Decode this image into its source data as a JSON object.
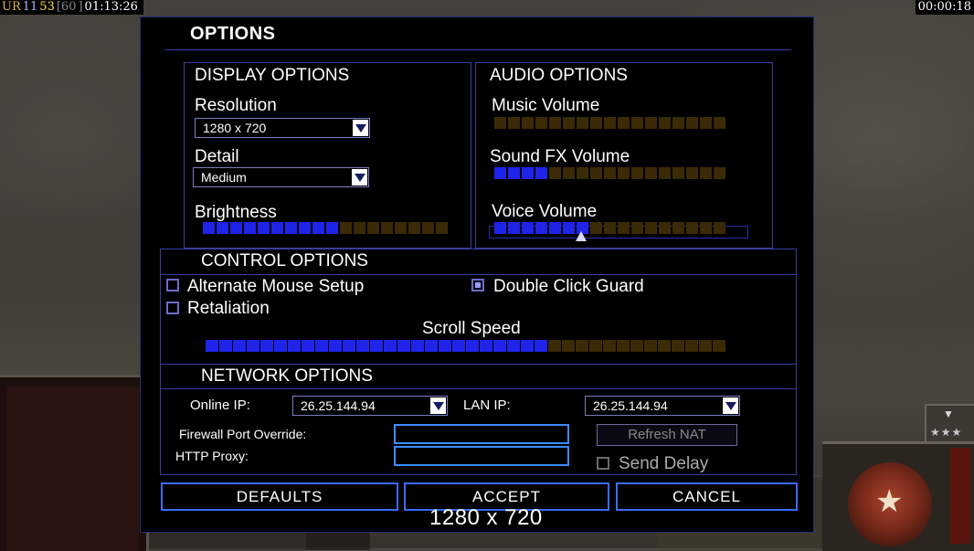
{
  "hud": {
    "left": [
      {
        "text": "UR",
        "color": "#e0b040"
      },
      {
        "text": "11",
        "color": "#b0b0ff"
      },
      {
        "text": "53",
        "color": "#ffe040"
      },
      {
        "text": "60",
        "color": "#888888"
      },
      {
        "text": "01:13:26",
        "color": "#ffffff"
      }
    ],
    "right": "00:00:18"
  },
  "dialog": {
    "title": "OPTIONS",
    "display": {
      "title": "DISPLAY OPTIONS",
      "resolution_label": "Resolution",
      "resolution_value": "1280 x 720",
      "detail_label": "Detail",
      "detail_value": "Medium",
      "brightness_label": "Brightness",
      "brightness_level": {
        "on": 10,
        "total": 18
      }
    },
    "audio": {
      "title": "AUDIO OPTIONS",
      "music_label": "Music Volume",
      "music_level": {
        "on": 0,
        "total": 17
      },
      "sfx_label": "Sound FX Volume",
      "sfx_level": {
        "on": 4,
        "total": 17
      },
      "voice_label": "Voice Volume",
      "voice_level": {
        "on": 7,
        "total": 17
      }
    },
    "control": {
      "title": "CONTROL OPTIONS",
      "alt_mouse_label": "Alternate Mouse Setup",
      "alt_mouse_checked": false,
      "double_click_label": "Double Click Guard",
      "double_click_checked": true,
      "retaliation_label": "Retaliation",
      "retaliation_checked": false,
      "scroll_label": "Scroll Speed",
      "scroll_level": {
        "on": 25,
        "total": 38
      }
    },
    "network": {
      "title": "NETWORK OPTIONS",
      "online_ip_label": "Online IP:",
      "online_ip_value": "26.25.144.94",
      "lan_ip_label": "LAN IP:",
      "lan_ip_value": "26.25.144.94",
      "firewall_label": "Firewall Port Override:",
      "firewall_value": "",
      "proxy_label": "HTTP Proxy:",
      "proxy_value": "",
      "refresh_nat_label": "Refresh NAT",
      "send_delay_label": "Send Delay",
      "send_delay_checked": false
    },
    "buttons": {
      "defaults": "DEFAULTS",
      "accept": "ACCEPT",
      "cancel": "CANCEL"
    },
    "overlay_resolution": "1280 x 720"
  },
  "colors": {
    "slider_on": "#1f24e8",
    "slider_off": "#3a2a06",
    "border": "#3a3ca0"
  }
}
